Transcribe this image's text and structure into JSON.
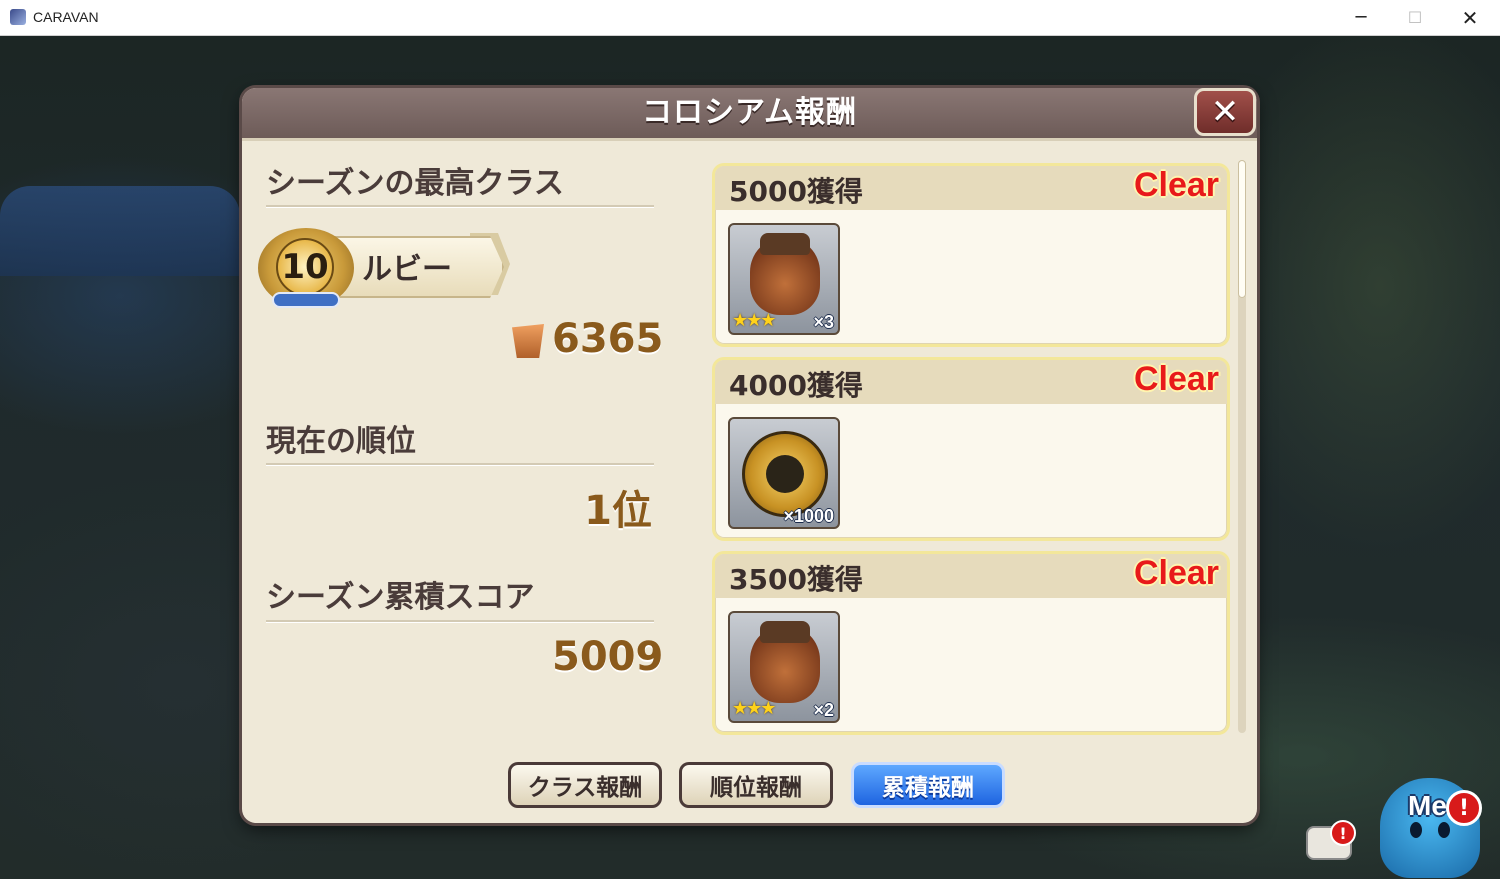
{
  "window": {
    "title": "CARAVAN",
    "minimize_glyph": "─",
    "maximize_glyph": "☐",
    "close_glyph": "✕"
  },
  "dialog": {
    "title": "コロシアム報酬",
    "close_glyph": "✕"
  },
  "season_best_class": {
    "label": "シーズンの最高クラス",
    "rank_number": "10",
    "rank_name": "ルビー",
    "points": "6365"
  },
  "current_rank": {
    "label": "現在の順位",
    "value": "1位"
  },
  "season_total_score": {
    "label": "シーズン累積スコア",
    "value": "5009"
  },
  "rewards": [
    {
      "title": "5000獲得",
      "status": "Clear",
      "item_icon": "bag-icon",
      "stars": "★★★",
      "quantity": "×3"
    },
    {
      "title": "4000獲得",
      "status": "Clear",
      "item_icon": "medal-icon",
      "stars": "",
      "quantity": "×1000"
    },
    {
      "title": "3500獲得",
      "status": "Clear",
      "item_icon": "bag-icon",
      "stars": "★★★",
      "quantity": "×2"
    }
  ],
  "tabs": [
    {
      "label": "クラス報酬",
      "active": false
    },
    {
      "label": "順位報酬",
      "active": false
    },
    {
      "label": "累積報酬",
      "active": true
    }
  ],
  "hud": {
    "chat_alert": "!",
    "mascot_label": "Me",
    "mascot_alert": "!"
  },
  "colors": {
    "clear_text": "#e81a1a",
    "active_tab": "#1e64e0",
    "score_number": "#8a5a1c"
  }
}
